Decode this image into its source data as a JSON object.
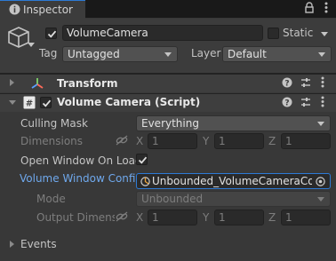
{
  "tab": {
    "title": "Inspector",
    "menu_icon": "kebab-icon",
    "lock_icon": "lock-icon"
  },
  "object": {
    "active": true,
    "name": "VolumeCamera",
    "static_label": "Static",
    "static": false,
    "tag_label": "Tag",
    "tag_value": "Untagged",
    "layer_label": "Layer",
    "layer_value": "Default"
  },
  "transform": {
    "title": "Transform"
  },
  "script": {
    "title": "Volume Camera (Script)",
    "enabled": true,
    "fields": {
      "culling_mask": {
        "label": "Culling Mask",
        "value": "Everything"
      },
      "dimensions": {
        "label": "Dimensions",
        "x_label": "X",
        "x": "1",
        "y_label": "Y",
        "y": "1",
        "z_label": "Z",
        "z": "1"
      },
      "open_window": {
        "label": "Open Window On Load",
        "checked": true
      },
      "window_config": {
        "label": "Volume Window Config",
        "value": "Unbounded_VolumeCameraCon"
      },
      "mode": {
        "label": "Mode",
        "value": "Unbounded"
      },
      "output_dims": {
        "label": "Output Dimensio",
        "x_label": "X",
        "x": "1",
        "y_label": "Y",
        "y": "1",
        "z_label": "Z",
        "z": "1"
      }
    }
  },
  "events": {
    "title": "Events"
  },
  "colors": {
    "accent": "#2d7ad5",
    "panel": "#383838",
    "header": "#3c3c3c"
  }
}
